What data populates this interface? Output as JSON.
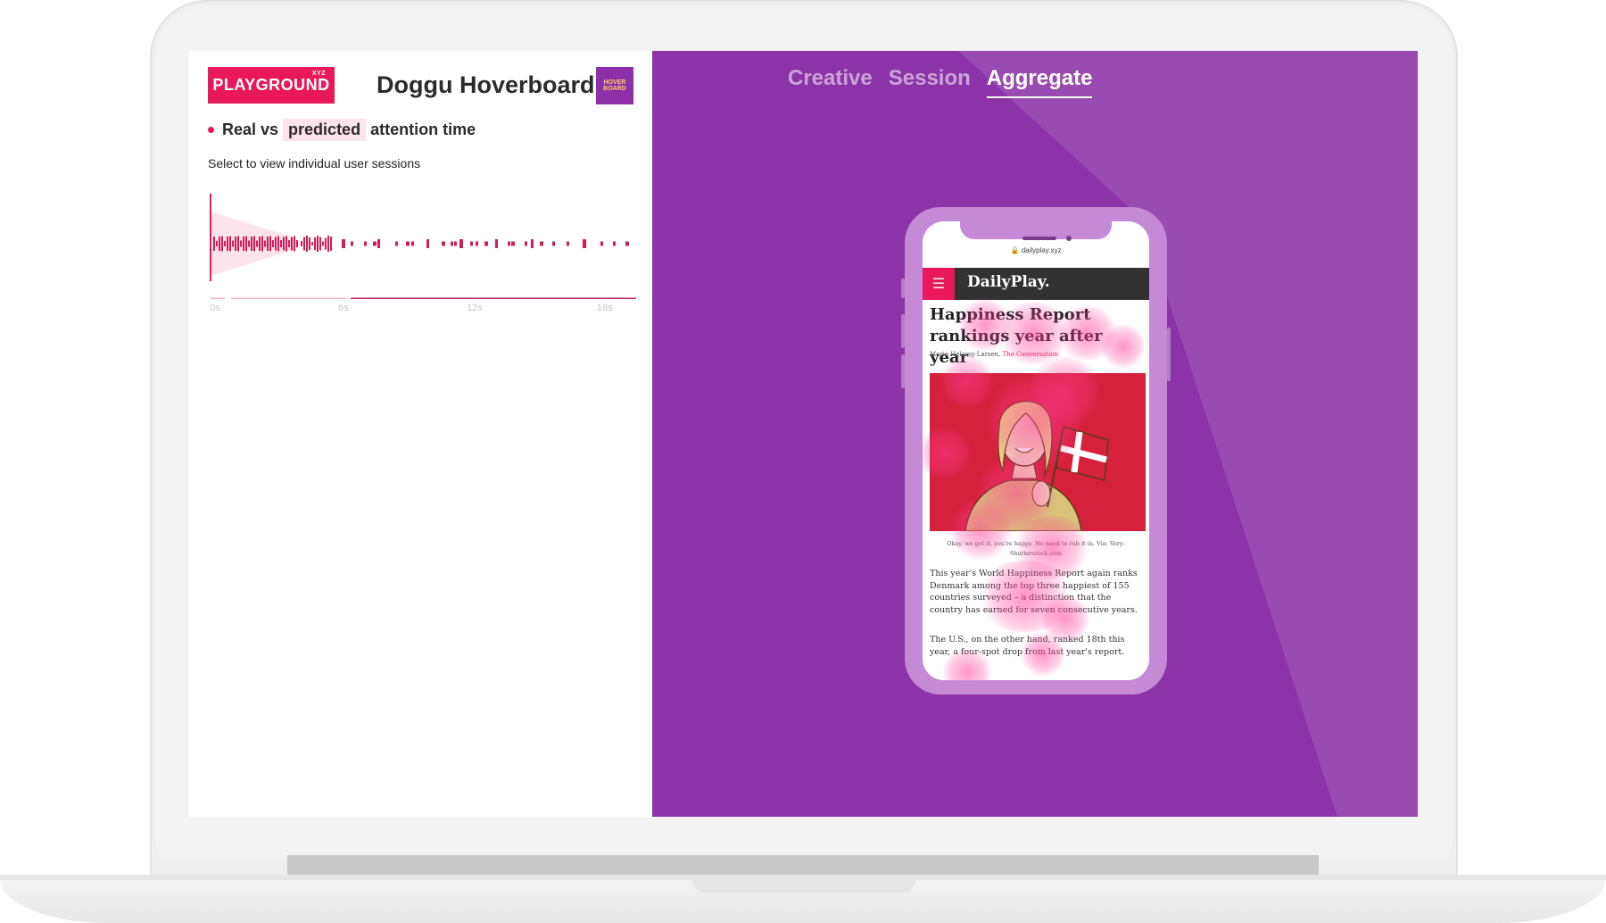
{
  "left_panel": {
    "logo_text": "PLAYGROUND",
    "logo_suffix": "XYZ",
    "creative_title": "Doggu Hoverboard",
    "creative_thumb_text": "HOVER BOARD",
    "legend": {
      "prefix": "Real vs",
      "highlight": "predicted",
      "suffix": "attention time"
    },
    "subtext": "Select to view individual user sessions",
    "ticks": [
      "0s",
      "6s",
      "12s",
      "18s"
    ]
  },
  "right_panel": {
    "tabs": [
      {
        "label": "Creative",
        "active": false
      },
      {
        "label": "Session",
        "active": false
      },
      {
        "label": "Aggregate",
        "active": true
      }
    ]
  },
  "phone": {
    "url": "dailyplay.xyz",
    "brand": "DailyPlay.",
    "headline": "Happiness Report rankings year after year",
    "byline_author": "Marie Helweg-Larsen,",
    "byline_source": "The Conversation",
    "caption": "Okay, we get it, you're happy. No need to rub it in. Via: Very-Shutterstock.com",
    "para1": "This year's World Happiness Report again ranks Denmark among the top three happiest of 155 countries surveyed – a distinction that the country has earned for seven consecutive years.",
    "para2": "The U.S., on the other hand, ranked 18th this year, a four-spot drop from last year's report."
  },
  "colors": {
    "brand_pink": "#e8185b",
    "panel_purple": "#8c33a8",
    "phone_frame": "#c48ad6"
  },
  "icons": {
    "lock": "lock-icon",
    "menu": "hamburger-menu-icon"
  }
}
